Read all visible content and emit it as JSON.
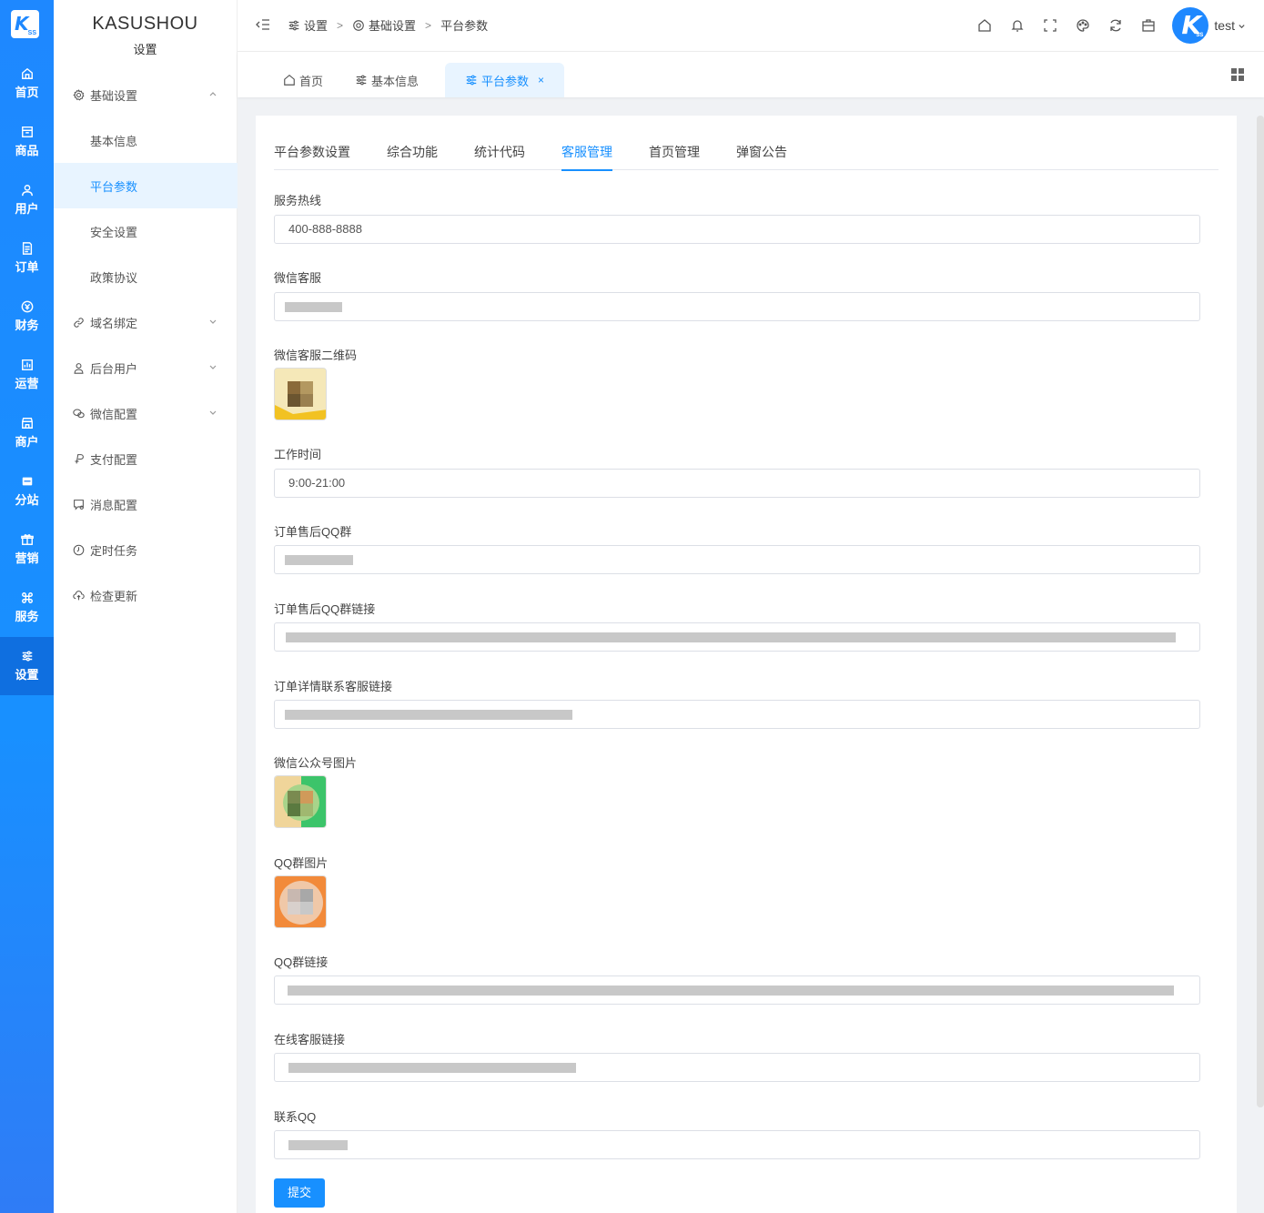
{
  "rail": {
    "logo": "K",
    "logo_sub": "SS",
    "items": [
      {
        "label": "首页",
        "icon": "home-icon"
      },
      {
        "label": "商品",
        "icon": "goods-icon"
      },
      {
        "label": "用户",
        "icon": "user-icon"
      },
      {
        "label": "订单",
        "icon": "order-icon"
      },
      {
        "label": "财务",
        "icon": "finance-icon"
      },
      {
        "label": "运营",
        "icon": "operation-icon"
      },
      {
        "label": "商户",
        "icon": "store-icon"
      },
      {
        "label": "分站",
        "icon": "substation-icon"
      },
      {
        "label": "营销",
        "icon": "gift-icon"
      },
      {
        "label": "服务",
        "icon": "command-icon"
      },
      {
        "label": "设置",
        "icon": "settings-sliders-icon",
        "active": true
      }
    ]
  },
  "sidebar": {
    "brand": "KASUSHOU",
    "section": "设置",
    "items": [
      {
        "label": "基础设置",
        "icon": "gear-icon",
        "expanded": true
      },
      {
        "label": "基本信息"
      },
      {
        "label": "平台参数",
        "active": true
      },
      {
        "label": "安全设置"
      },
      {
        "label": "政策协议"
      },
      {
        "label": "域名绑定",
        "icon": "link-icon"
      },
      {
        "label": "后台用户",
        "icon": "user-icon"
      },
      {
        "label": "微信配置",
        "icon": "wechat-icon"
      },
      {
        "label": "支付配置",
        "icon": "payment-icon"
      },
      {
        "label": "消息配置",
        "icon": "message-icon"
      },
      {
        "label": "定时任务",
        "icon": "clock-icon"
      },
      {
        "label": "检查更新",
        "icon": "cloud-upload-icon"
      }
    ]
  },
  "header": {
    "breadcrumb": [
      "设置",
      "基础设置",
      "平台参数"
    ],
    "separator": ">",
    "user": "test"
  },
  "page_tabs": [
    {
      "label": "首页"
    },
    {
      "label": "基本信息"
    },
    {
      "label": "平台参数",
      "active": true,
      "close": "×"
    }
  ],
  "form_tabs": [
    "平台参数设置",
    "综合功能",
    "统计代码",
    "客服管理",
    "首页管理",
    "弹窗公告"
  ],
  "active_form_tab": "客服管理",
  "form": {
    "hotline_label": "服务热线",
    "hotline_value": "400-888-8888",
    "wechat_label": "微信客服",
    "wechat_qr_label": "微信客服二维码",
    "worktime_label": "工作时间",
    "worktime_value": "9:00-21:00",
    "qq_group_label": "订单售后QQ群",
    "qq_group_link_label": "订单售后QQ群链接",
    "order_service_link_label": "订单详情联系客服链接",
    "mp_image_label": "微信公众号图片",
    "qq_image_label": "QQ群图片",
    "qq_link_label": "QQ群链接",
    "online_service_label": "在线客服链接",
    "contact_qq_label": "联系QQ",
    "submit_label": "提交"
  },
  "colors": {
    "primary": "#1890ff",
    "rail": "#1e88ff"
  }
}
